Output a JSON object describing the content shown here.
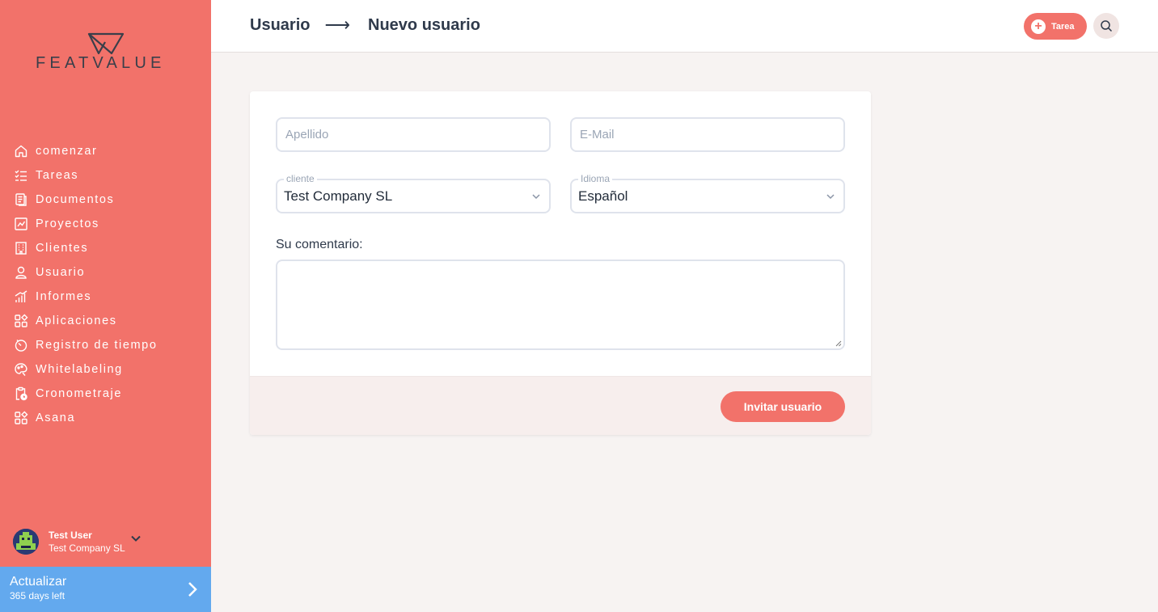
{
  "brand": {
    "name": "FEATVALUE",
    "accent": "#f2726a",
    "upgrade_color": "#63a9ee"
  },
  "sidebar": {
    "items": [
      {
        "label": "comenzar",
        "icon": "home-icon"
      },
      {
        "label": "Tareas",
        "icon": "tasks-icon"
      },
      {
        "label": "Documentos",
        "icon": "documents-icon"
      },
      {
        "label": "Proyectos",
        "icon": "projects-icon"
      },
      {
        "label": "Clientes",
        "icon": "building-icon"
      },
      {
        "label": "Usuario",
        "icon": "user-icon"
      },
      {
        "label": "Informes",
        "icon": "reports-icon"
      },
      {
        "label": "Aplicaciones",
        "icon": "apps-icon"
      },
      {
        "label": "Registro de tiempo",
        "icon": "timer-icon"
      },
      {
        "label": "Whitelabeling",
        "icon": "palette-icon"
      },
      {
        "label": "Cronometraje",
        "icon": "clipboard-clock-icon"
      },
      {
        "label": "Asana",
        "icon": "apps-icon"
      }
    ],
    "user": {
      "name": "Test User",
      "company": "Test Company SL"
    },
    "upgrade": {
      "title": "Actualizar",
      "subtitle": "365 days left"
    }
  },
  "header": {
    "breadcrumb": [
      "Usuario",
      "Nuevo usuario"
    ],
    "arrow": "⟶",
    "task_button": "Tarea"
  },
  "form": {
    "lastname_placeholder": "Apellido",
    "email_placeholder": "E-Mail",
    "client_label": "cliente",
    "client_value": "Test Company SL",
    "language_label": "Idioma",
    "language_value": "Español",
    "comment_label": "Su comentario:",
    "submit": "Invitar usuario"
  }
}
